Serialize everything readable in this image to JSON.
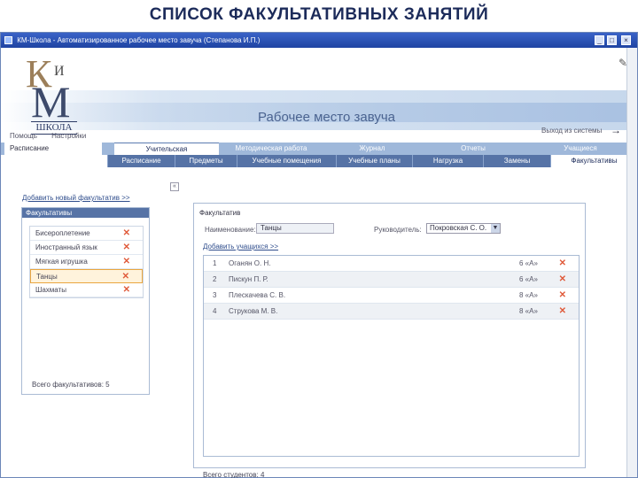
{
  "slide_title": "СПИСОК ФАКУЛЬТАТИВНЫХ ЗАНЯТИЙ",
  "window": {
    "title": "КМ-Школа - Автоматизированное рабочее место завуча (Степанова И.П.)",
    "btn_min": "_",
    "btn_max": "□",
    "btn_close": "×"
  },
  "logo": {
    "k": "К",
    "i": "И",
    "m": "М",
    "school": "ШКОЛА"
  },
  "header": {
    "workplace_title": "Рабочее место завуча",
    "exit": "Выход из системы",
    "exit_arrow": "→",
    "edit_icon": "✎"
  },
  "top_menu": {
    "help": "Помощь",
    "settings": "Настройки"
  },
  "main_tabs": {
    "schedule": "Расписание",
    "items": [
      "Учительская",
      "Методическая работа",
      "Журнал",
      "Отчеты",
      "Учащиеся"
    ]
  },
  "sub_tabs": [
    "Расписание",
    "Предметы",
    "Учебные помещения",
    "Учебные планы",
    "Нагрузка",
    "Замены",
    "Факультативы"
  ],
  "left_panel": {
    "add_link": "Добавить новый факультатив >>",
    "collapse": "«",
    "header": "Факультативы",
    "items": [
      {
        "name": "Бисероплетение"
      },
      {
        "name": "Иностранный язык"
      },
      {
        "name": "Мягкая игрушка"
      },
      {
        "name": "Танцы"
      },
      {
        "name": "Шахматы"
      }
    ],
    "total": "Всего факультативов: 5"
  },
  "right_panel": {
    "label": "Факультатив",
    "name_label": "Наименование:",
    "name_value": "Танцы",
    "lead_label": "Руководитель:",
    "lead_value": "Покровская С. О.",
    "lead_arrow": "▼",
    "add_link": "Добавить учащихся >>",
    "students": [
      {
        "num": "1",
        "name": "Оганян О. Н.",
        "grade": "6 «А»"
      },
      {
        "num": "2",
        "name": "Пискун П. Р.",
        "grade": "6 «А»"
      },
      {
        "num": "3",
        "name": "Плескачева С. В.",
        "grade": "8 «А»"
      },
      {
        "num": "4",
        "name": "Струкова М. В.",
        "grade": "8 «А»"
      }
    ],
    "total": "Всего студентов: 4"
  },
  "delete_glyph": "✕",
  "colors": {
    "accent": "#5673a6",
    "delete": "#e05a3a",
    "selected_border": "#e9a640",
    "title": "#1c2b5a"
  }
}
